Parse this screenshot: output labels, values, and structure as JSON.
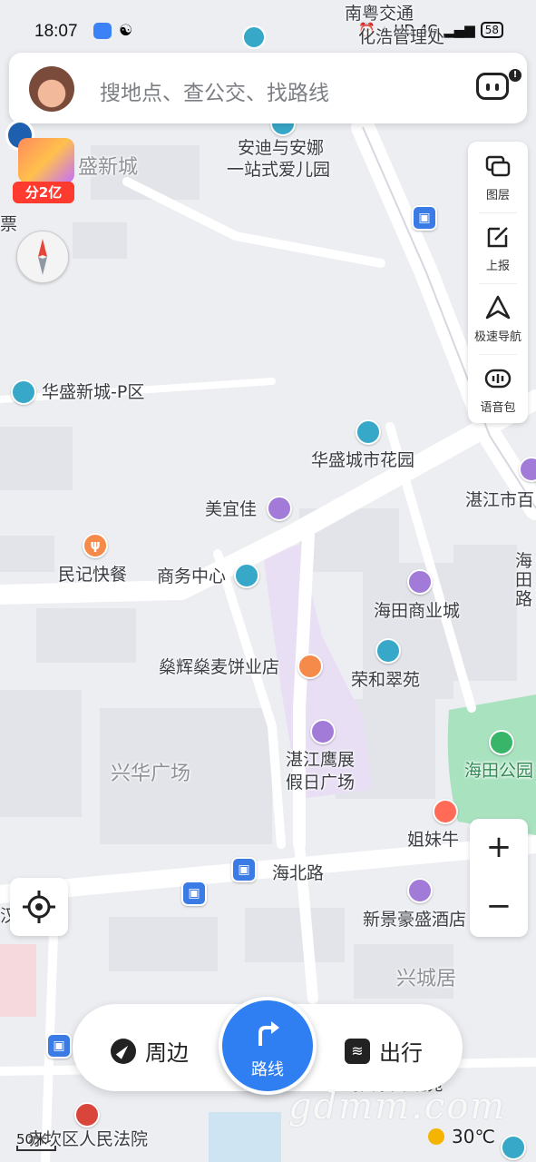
{
  "status_bar": {
    "time": "18:07",
    "indicators": "HD 4G",
    "battery": "58"
  },
  "search": {
    "placeholder": "搜地点、查公交、找路线"
  },
  "promo": {
    "badge": "分2亿"
  },
  "tools": [
    {
      "label": "图层",
      "icon": "layers-icon"
    },
    {
      "label": "上报",
      "icon": "report-icon"
    },
    {
      "label": "极速导航",
      "icon": "navigation-arrow-icon"
    },
    {
      "label": "语音包",
      "icon": "voice-pack-icon"
    }
  ],
  "map": {
    "labels": {
      "top_road": "南粤交通",
      "top_office": "化浩管理处",
      "kindergarten_1": "安迪与安娜",
      "kindergarten_2": "一站式爱儿园",
      "area_huasheng": "盛新城",
      "left_edge": "票",
      "huasheng_p": "华盛新城-P区",
      "garden": "华盛城市花园",
      "meiyijia": "美宜佳",
      "zhanjiang_right": "湛江市百",
      "minji": "民记快餐",
      "business": "商务中心",
      "haitian_mall": "海田商业城",
      "haitian_right": "海田路",
      "bakery": "燊辉燊麦饼业店",
      "ronghe": "荣和翠苑",
      "xinghua": "兴华广场",
      "zhanjiang_1": "湛江鹰展",
      "zhanjiang_2": "假日广场",
      "haitian_park": "海田公园",
      "jiemei": "姐妹牛",
      "haibei": "海北路",
      "hotel": "新景豪盛酒店",
      "xingcheng": "兴城居",
      "court": "赤坎区人民法院",
      "haitian_north": "海田家园-北苑",
      "left_small": "汉"
    }
  },
  "controls": {
    "zoom_in": "+",
    "zoom_out": "−"
  },
  "bottom_nav": {
    "nearby": "周边",
    "route": "路线",
    "travel": "出行"
  },
  "scale": "50米",
  "weather": {
    "temp": "30℃"
  },
  "watermark": "gdmm.com"
}
